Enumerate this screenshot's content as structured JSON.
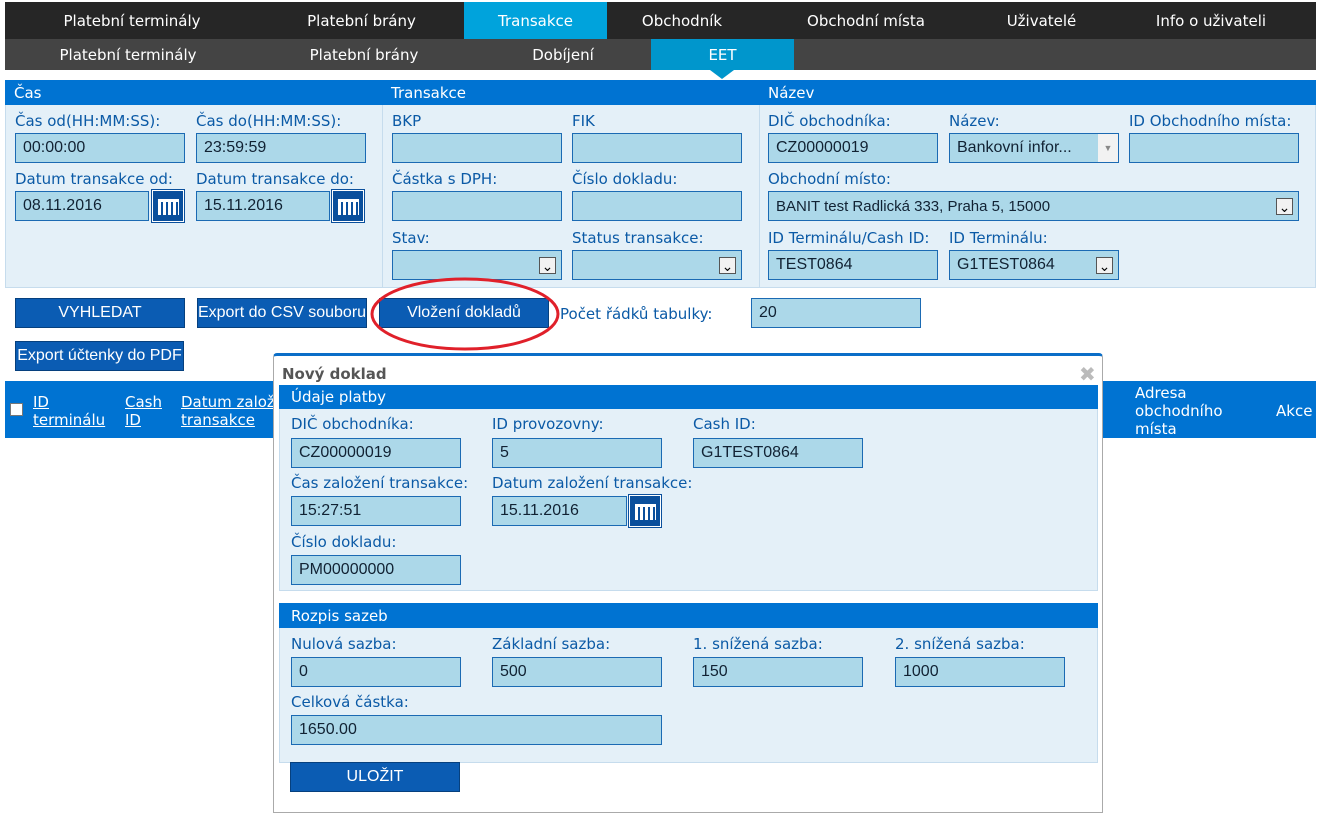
{
  "nav": {
    "main": [
      "Platební terminály",
      "Platební brány",
      "Transakce",
      "Obchodník",
      "Obchodní místa",
      "Uživatelé",
      "Info o uživateli"
    ],
    "main_active": "Transakce",
    "sub": [
      "Platební terminály",
      "Platební brány",
      "Dobíjení",
      "EET"
    ],
    "sub_active": "EET"
  },
  "filter": {
    "cas": {
      "title": "Čas",
      "od_label": "Čas od(HH:MM:SS):",
      "od": "00:00:00",
      "do_label": "Čas do(HH:MM:SS):",
      "do": "23:59:59",
      "datum_od_label": "Datum transakce od:",
      "datum_od": "08.11.2016",
      "datum_do_label": "Datum transakce do:",
      "datum_do": "15.11.2016"
    },
    "transakce": {
      "title": "Transakce",
      "bkp_label": "BKP",
      "bkp": "",
      "fik_label": "FIK",
      "fik": "",
      "castka_label": "Částka s DPH:",
      "castka": "",
      "cislo_label": "Číslo dokladu:",
      "cislo": "",
      "stav_label": "Stav:",
      "stav": "",
      "status_label": "Status transakce:",
      "status": ""
    },
    "nazev": {
      "title": "Název",
      "dic_label": "DIČ obchodníka:",
      "dic": "CZ00000019",
      "nazev_label": "Název:",
      "nazev": "Bankovní infor...",
      "idmista_label": "ID Obchodního místa:",
      "idmista": "",
      "misto_label": "Obchodní místo:",
      "misto": "BANIT test Radlická 333, Praha 5, 15000",
      "cashid_label": "ID Terminálu/Cash ID:",
      "cashid": "TEST0864",
      "idterm_label": "ID Terminálu:",
      "idterm": "G1TEST0864"
    }
  },
  "actions": {
    "search": "VYHLEDAT",
    "export_csv": "Export do CSV souboru",
    "insert": "Vložení dokladů",
    "rows_label": "Počet řádků tabulky:",
    "rows": "20",
    "export_pdf": "Export účtenky do PDF"
  },
  "table": {
    "headers": [
      "ID terminálu",
      "Cash ID",
      "Datum založení transakce",
      "Adresa obchodního místa",
      "Akce"
    ]
  },
  "modal": {
    "title": "Nový doklad",
    "s1": {
      "title": "Údaje platby",
      "dic_label": "DIČ obchodníka:",
      "dic": "CZ00000019",
      "prov_label": "ID provozovny:",
      "prov": "5",
      "cash_label": "Cash ID:",
      "cash": "G1TEST0864",
      "cas_label": "Čas založení transakce:",
      "cas": "15:27:51",
      "datum_label": "Datum založení transakce:",
      "datum": "15.11.2016",
      "cislo_label": "Číslo dokladu:",
      "cislo": "PM00000000"
    },
    "s2": {
      "title": "Rozpis sazeb",
      "nulova_label": "Nulová sazba:",
      "nulova": "0",
      "zakladni_label": "Základní sazba:",
      "zakladni": "500",
      "sn1_label": "1. snížená sazba:",
      "sn1": "150",
      "sn2_label": "2. snížená sazba:",
      "sn2": "1000",
      "celkem_label": "Celková částka:",
      "celkem": "1650.00"
    },
    "save": "ULOŽIT"
  },
  "colors": {
    "accent": "#0073d2",
    "nav_active": "#00a3dc",
    "highlight": "#e0202a"
  }
}
